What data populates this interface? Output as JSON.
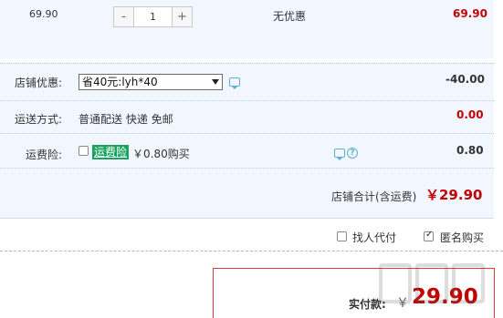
{
  "item": {
    "unit_price": "69.90",
    "quantity": "1",
    "minus_label": "-",
    "plus_label": "+",
    "discount": "无优惠",
    "subtotal": "69.90"
  },
  "order": {
    "coupon": {
      "label": "店铺优惠:",
      "selected": "省40元:lyh*40",
      "amount": "-40.00"
    },
    "shipping": {
      "label": "运送方式:",
      "method": "普通配送 快递 免邮",
      "amount": "0.00"
    },
    "insurance": {
      "label": "运费险:",
      "tag": "运费险",
      "price": "￥0.80购买",
      "amount": "0.80",
      "help": "?"
    },
    "store_total": {
      "label": "店铺合计(含运费)",
      "amount": "￥29.90"
    }
  },
  "options": {
    "proxy_pay": {
      "label": "找人代付",
      "checked": false
    },
    "anonymous": {
      "label": "匿名购买",
      "checked": true
    }
  },
  "payment": {
    "label": "实付款:",
    "currency": "￥",
    "amount": "29.90"
  },
  "colors": {
    "price_red": "#c40000",
    "panel_bg": "#f2f7ff",
    "tag_green": "#1aa260",
    "box_border": "#e43a3a"
  }
}
